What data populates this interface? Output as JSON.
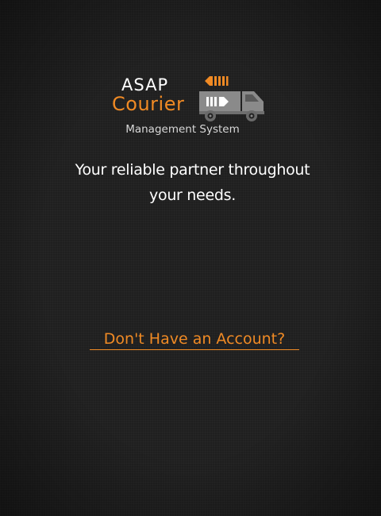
{
  "logo": {
    "word_top": "ASAP",
    "word_bottom": "Courier",
    "icon": "courier-truck-icon",
    "subtitle": "Management System"
  },
  "tagline": {
    "line1": "Your reliable partner throughout",
    "line2": "your needs."
  },
  "signup_link": {
    "label": "Don't Have an Account?"
  },
  "colors": {
    "background": "#1f1f1f",
    "accent": "#f08a24",
    "text": "#ffffff",
    "truck": "#8a8a8a"
  }
}
